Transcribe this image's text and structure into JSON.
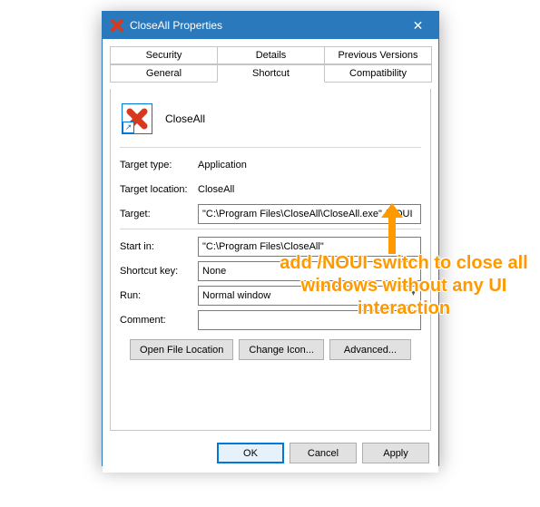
{
  "window": {
    "title": "CloseAll Properties"
  },
  "tabs": {
    "row1": [
      "Security",
      "Details",
      "Previous Versions"
    ],
    "row2": [
      "General",
      "Shortcut",
      "Compatibility"
    ],
    "active": "Shortcut"
  },
  "header": {
    "app_name": "CloseAll"
  },
  "fields": {
    "target_type_label": "Target type:",
    "target_type_value": "Application",
    "target_location_label": "Target location:",
    "target_location_value": "CloseAll",
    "target_label": "Target:",
    "target_value": "\"C:\\Program Files\\CloseAll\\CloseAll.exe\" /NOUI",
    "start_in_label": "Start in:",
    "start_in_value": "\"C:\\Program Files\\CloseAll\"",
    "shortcut_key_label": "Shortcut key:",
    "shortcut_key_value": "None",
    "run_label": "Run:",
    "run_value": "Normal window",
    "comment_label": "Comment:",
    "comment_value": ""
  },
  "buttons": {
    "open_file_location": "Open File Location",
    "change_icon": "Change Icon...",
    "advanced": "Advanced...",
    "ok": "OK",
    "cancel": "Cancel",
    "apply": "Apply"
  },
  "annotation": {
    "text": "add /NOUI switch to close all windows without any UI interaction"
  }
}
